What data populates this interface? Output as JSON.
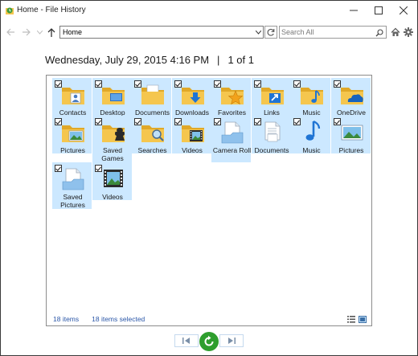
{
  "window": {
    "title": "Home - File History",
    "app_icon": "file-history-icon"
  },
  "navbar": {
    "address": "Home",
    "search_placeholder": "Search All"
  },
  "heading": {
    "date": "Wednesday, July 29, 2015 4:16 PM",
    "separator": "|",
    "page": "1 of 1"
  },
  "items": [
    {
      "label": "Contacts",
      "icon": "contacts-folder-icon",
      "checked": true
    },
    {
      "label": "Desktop",
      "icon": "desktop-folder-icon",
      "checked": true
    },
    {
      "label": "Documents",
      "icon": "documents-folder-icon",
      "checked": true
    },
    {
      "label": "Downloads",
      "icon": "downloads-folder-icon",
      "checked": true
    },
    {
      "label": "Favorites",
      "icon": "favorites-folder-icon",
      "checked": true
    },
    {
      "label": "Links",
      "icon": "links-folder-icon",
      "checked": true
    },
    {
      "label": "Music",
      "icon": "music-folder-icon",
      "checked": true
    },
    {
      "label": "OneDrive",
      "icon": "onedrive-folder-icon",
      "checked": true
    },
    {
      "label": "Pictures",
      "icon": "pictures-folder-icon",
      "checked": true
    },
    {
      "label": "Saved Games",
      "icon": "saved-games-folder-icon",
      "checked": true
    },
    {
      "label": "Searches",
      "icon": "searches-folder-icon",
      "checked": true
    },
    {
      "label": "Videos",
      "icon": "videos-folder-icon",
      "checked": true
    },
    {
      "label": "Camera Roll",
      "icon": "camera-roll-library-icon",
      "checked": true
    },
    {
      "label": "Documents",
      "icon": "documents-library-icon",
      "checked": true
    },
    {
      "label": "Music",
      "icon": "music-library-icon",
      "checked": true
    },
    {
      "label": "Pictures",
      "icon": "pictures-library-icon",
      "checked": true
    },
    {
      "label": "Saved Pictures",
      "icon": "saved-pictures-library-icon",
      "checked": true
    },
    {
      "label": "Videos",
      "icon": "videos-library-icon",
      "checked": true
    }
  ],
  "status": {
    "item_count": "18 items",
    "selected_count": "18 items selected"
  },
  "colors": {
    "selection": "#cce8ff",
    "folder": "#f5c64e",
    "status_text": "#2b57a8",
    "restore": "#2e9e2e"
  }
}
